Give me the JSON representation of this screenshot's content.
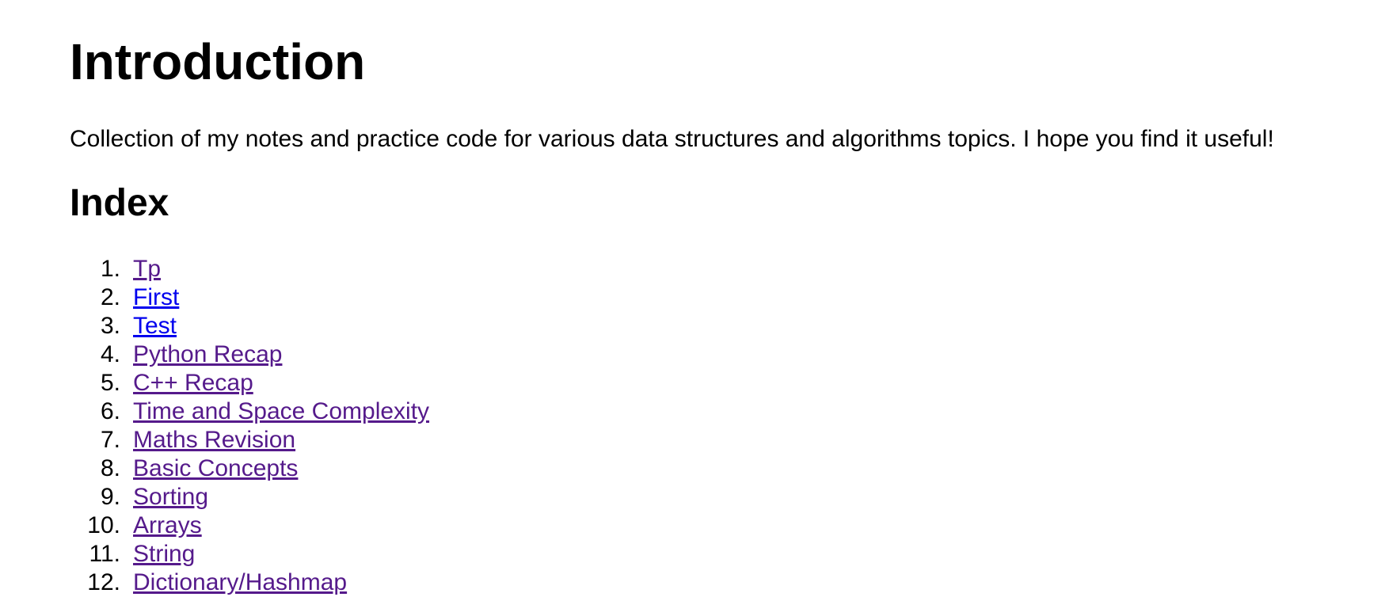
{
  "intro": {
    "heading": "Introduction",
    "text": "Collection of my notes and practice code for various data structures and algorithms topics. I hope you find it useful!"
  },
  "index": {
    "heading": "Index",
    "items": [
      {
        "number": "1.",
        "label": "Tp",
        "visited": true
      },
      {
        "number": "2.",
        "label": "First",
        "visited": false
      },
      {
        "number": "3.",
        "label": "Test",
        "visited": false
      },
      {
        "number": "4.",
        "label": "Python Recap",
        "visited": true
      },
      {
        "number": "5.",
        "label": "C++ Recap",
        "visited": true
      },
      {
        "number": "6.",
        "label": "Time and Space Complexity",
        "visited": true
      },
      {
        "number": "7.",
        "label": "Maths Revision",
        "visited": true
      },
      {
        "number": "8.",
        "label": "Basic Concepts",
        "visited": true
      },
      {
        "number": "9.",
        "label": "Sorting",
        "visited": true
      },
      {
        "number": "10.",
        "label": "Arrays",
        "visited": true
      },
      {
        "number": "11.",
        "label": "String",
        "visited": true
      },
      {
        "number": "12.",
        "label": "Dictionary/Hashmap",
        "visited": true
      }
    ]
  },
  "colors": {
    "link_visited": "#551a8b",
    "link_unvisited": "#0000ee",
    "text": "#000000",
    "background": "#ffffff"
  }
}
